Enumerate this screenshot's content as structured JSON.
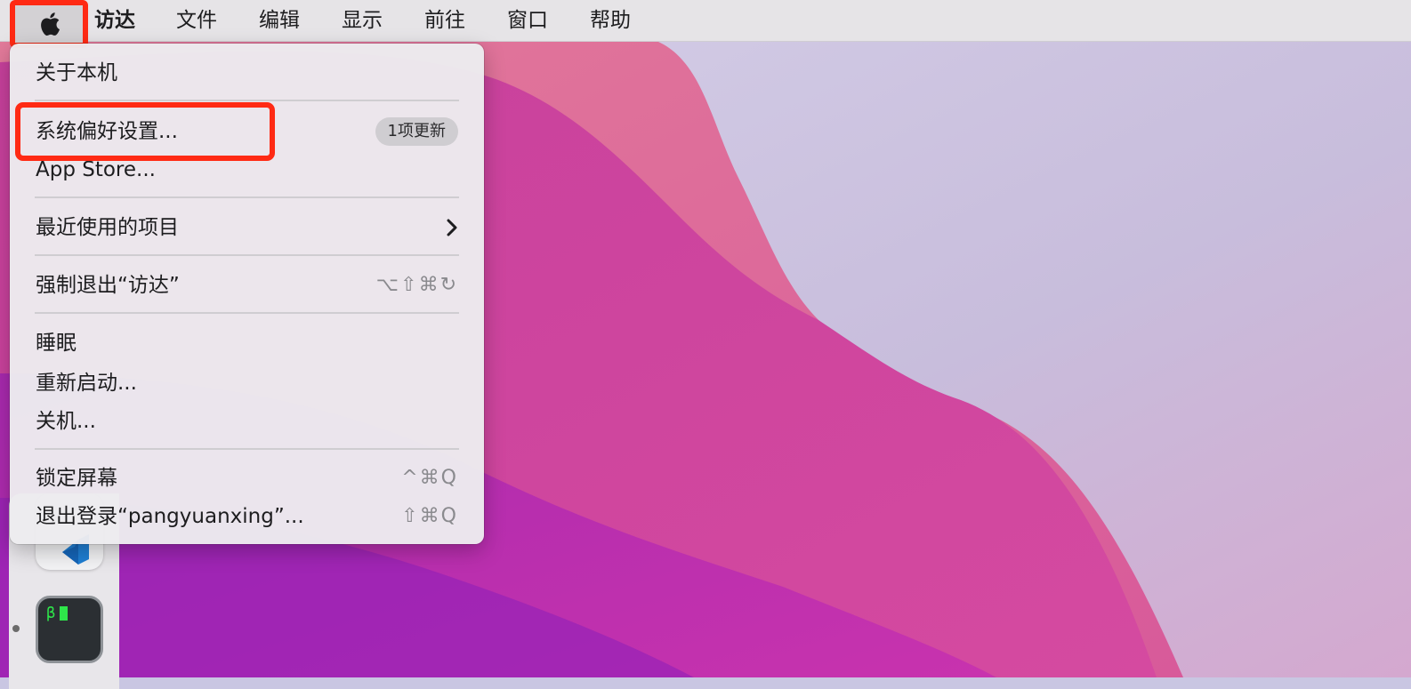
{
  "menubar": {
    "items": [
      "访达",
      "文件",
      "编辑",
      "显示",
      "前往",
      "窗口",
      "帮助"
    ]
  },
  "apple_menu": {
    "about": "关于本机",
    "system_prefs": "系统偏好设置...",
    "system_prefs_badge": "1项更新",
    "app_store": "App Store...",
    "recent_items": "最近使用的项目",
    "force_quit": "强制退出“访达”",
    "force_quit_shortcut": "⌥⇧⌘↻",
    "sleep": "睡眠",
    "restart": "重新启动...",
    "shutdown": "关机...",
    "lock_screen": "锁定屏幕",
    "lock_screen_shortcut": "^⌘Q",
    "logout": "退出登录“pangyuanxing”...",
    "logout_shortcut": "⇧⌘Q"
  },
  "dock": {
    "terminal_text": "β"
  },
  "colors": {
    "highlight": "#ff2a14",
    "menubar": "#e6e4e7"
  }
}
